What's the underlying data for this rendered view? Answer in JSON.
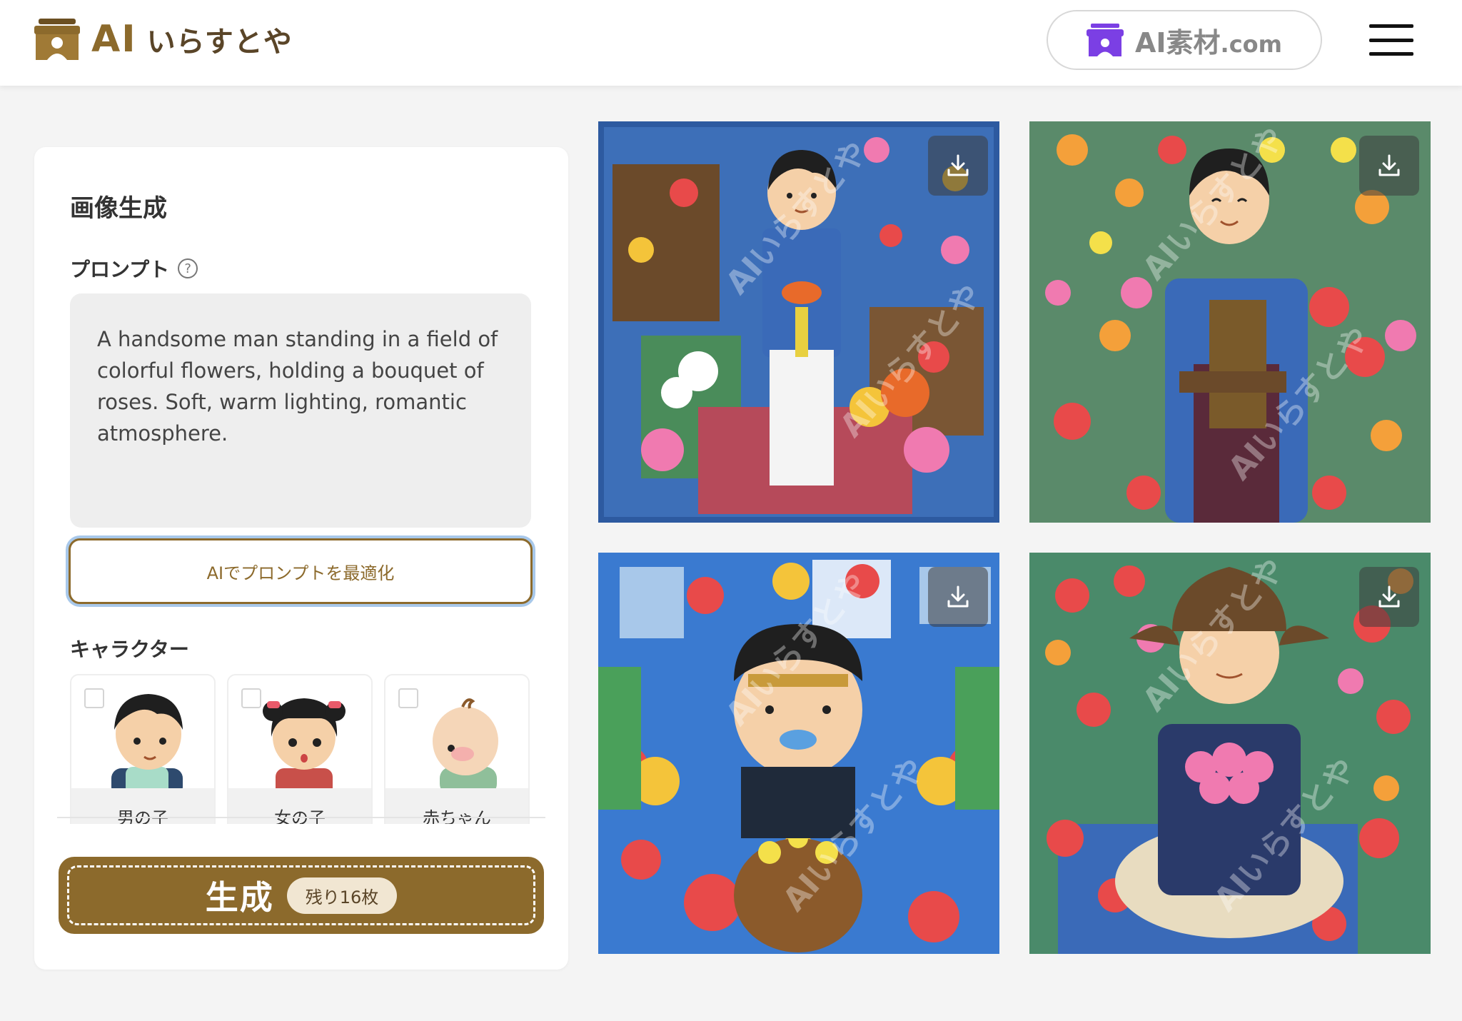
{
  "header": {
    "logo_ai": "AI",
    "logo_text": "いらすとや",
    "sozai_label": "AI素材",
    "sozai_suffix": ".com"
  },
  "panel": {
    "title": "画像生成",
    "prompt_label": "プロンプト",
    "help_glyph": "?",
    "prompt_value": "A handsome man standing in a field of colorful flowers, holding a bouquet of roses. Soft, warm lighting, romantic atmosphere.",
    "optimize_label": "AIでプロンプトを最適化",
    "character_label": "キャラクター",
    "characters": [
      {
        "name": "男の子"
      },
      {
        "name": "女の子"
      },
      {
        "name": "赤ちゃん"
      }
    ],
    "generate_label": "生成",
    "remaining_label": "残り16枚"
  },
  "images": [
    {
      "watermark": "AIいらすとや"
    },
    {
      "watermark": "AIいらすとや"
    },
    {
      "watermark": "AIいらすとや"
    },
    {
      "watermark": "AIいらすとや"
    }
  ],
  "colors": {
    "brand": "#8c6a2c",
    "focus_ring": "#a8c8ea",
    "sozai_icon": "#7b3fe4"
  },
  "icons": {
    "menu": "hamburger-icon",
    "download": "download-icon",
    "help": "question-circle-icon",
    "logo": "shop-icon"
  }
}
